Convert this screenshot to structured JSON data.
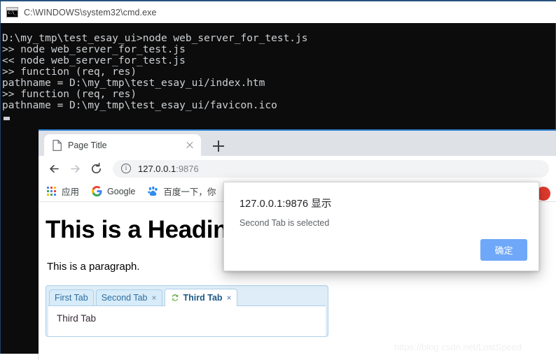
{
  "cmd": {
    "title": "C:\\WINDOWS\\system32\\cmd.exe",
    "icon": "cmd-console-icon",
    "lines": [
      "D:\\my_tmp\\test_esay_ui>node web_server_for_test.js",
      ">> node web_server_for_test.js",
      "<< node web_server_for_test.js",
      ">> function (req, res)",
      "pathname = D:\\my_tmp\\test_esay_ui/index.htm",
      ">> function (req, res)",
      "pathname = D:\\my_tmp\\test_esay_ui/favicon.ico"
    ]
  },
  "browser": {
    "tab": {
      "title": "Page Title",
      "page_icon": "page-document-icon",
      "close_icon": "close-icon"
    },
    "new_tab_icon": "plus-icon",
    "nav": {
      "back_icon": "arrow-left-icon",
      "forward_icon": "arrow-right-icon",
      "reload_icon": "reload-icon"
    },
    "omnibox": {
      "security_icon": "info-circle-icon",
      "url_host": "127.0.0.1",
      "url_rest": ":9876",
      "full_url": "127.0.0.1:9876"
    },
    "bookmarks": [
      {
        "label": "应用",
        "icon": "apps-grid-icon"
      },
      {
        "label": "Google",
        "icon": "google-g-icon"
      },
      {
        "label": "百度一下，你",
        "icon": "baidu-paw-icon"
      }
    ],
    "bookmark_overflow_icon": "red-circle-icon"
  },
  "page": {
    "heading": "This is a Heading",
    "paragraph": "This is a paragraph.",
    "tabs": [
      {
        "label": "First Tab",
        "closable": false,
        "active": false,
        "close_glyph": ""
      },
      {
        "label": "Second Tab",
        "closable": true,
        "active": false,
        "close_glyph": "×"
      },
      {
        "label": "Third Tab",
        "closable": true,
        "active": true,
        "close_glyph": "×",
        "icon": "loading-spinner-icon"
      }
    ],
    "panel_text": "Third Tab"
  },
  "dialog": {
    "origin": "127.0.0.1:9876 显示",
    "message": "Second Tab is selected",
    "ok_label": "确定",
    "accent_color": "#6fa8f8"
  },
  "watermark": "https://blog.csdn.net/LostSpeed",
  "colors": {
    "cmd_background": "#0c0c0c",
    "cmd_text": "#ccd0d4",
    "browser_chrome": "#dee1e6",
    "jqui_border": "#aed0ea",
    "jqui_tab_text": "#2e6e9e",
    "dialog_accent": "#6fa8f8"
  }
}
